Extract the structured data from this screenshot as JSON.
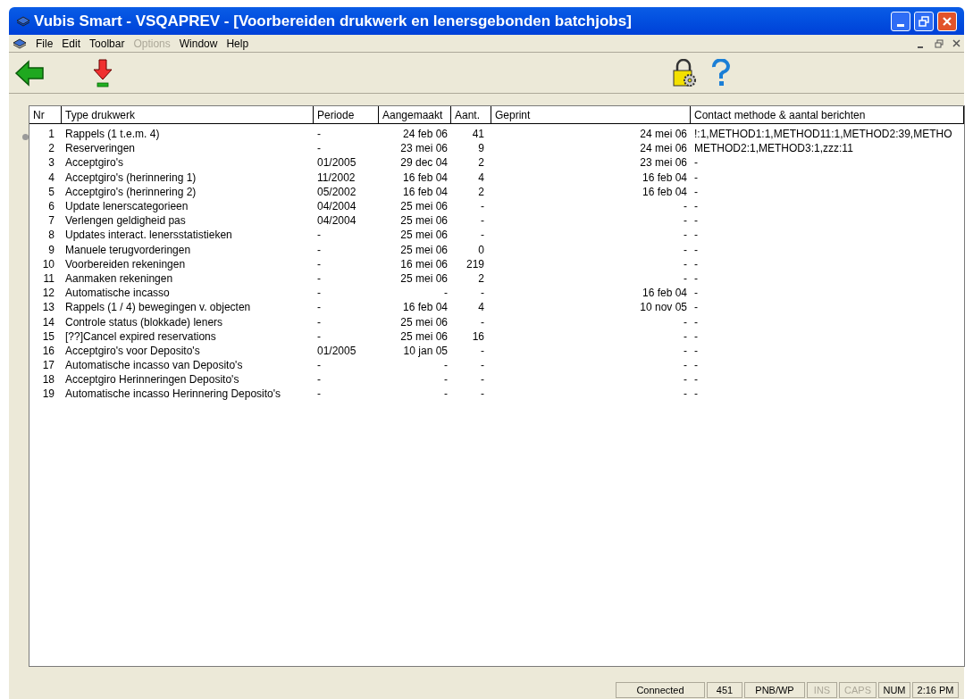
{
  "window": {
    "title": "Vubis Smart - VSQAPREV - [Voorbereiden drukwerk en lenersgebonden batchjobs]"
  },
  "menu": [
    {
      "label": "File",
      "disabled": false
    },
    {
      "label": "Edit",
      "disabled": false
    },
    {
      "label": "Toolbar",
      "disabled": false
    },
    {
      "label": "Options",
      "disabled": true
    },
    {
      "label": "Window",
      "disabled": false
    },
    {
      "label": "Help",
      "disabled": false
    }
  ],
  "table": {
    "columns": [
      "Nr",
      "Type drukwerk",
      "Periode",
      "Aangemaakt",
      "Aant.",
      "Geprint",
      "Contact methode & aantal berichten"
    ],
    "rows": [
      {
        "selected": true,
        "cells": [
          "1",
          "Rappels (1 t.e.m. 4)",
          "-",
          "24 feb 06",
          "41",
          "24 mei 06",
          "!:1,METHOD1:1,METHOD11:1,METHOD2:39,METHO"
        ]
      },
      {
        "selected": false,
        "cells": [
          "2",
          "Reserveringen",
          "-",
          "23 mei 06",
          "9",
          "24 mei 06",
          "METHOD2:1,METHOD3:1,zzz:11"
        ]
      },
      {
        "selected": false,
        "cells": [
          "3",
          "Acceptgiro's",
          "01/2005",
          "29 dec 04",
          "2",
          "23 mei 06",
          "-"
        ]
      },
      {
        "selected": false,
        "cells": [
          "4",
          "Acceptgiro's (herinnering 1)",
          "11/2002",
          "16 feb 04",
          "4",
          "16 feb 04",
          "-"
        ]
      },
      {
        "selected": false,
        "cells": [
          "5",
          "Acceptgiro's (herinnering 2)",
          "05/2002",
          "16 feb 04",
          "2",
          "16 feb 04",
          "-"
        ]
      },
      {
        "selected": false,
        "cells": [
          "6",
          "Update lenerscategorieen",
          "04/2004",
          "25 mei 06",
          "-",
          "-",
          "-"
        ]
      },
      {
        "selected": false,
        "cells": [
          "7",
          "Verlengen geldigheid pas",
          "04/2004",
          "25 mei 06",
          "-",
          "-",
          "-"
        ]
      },
      {
        "selected": false,
        "cells": [
          "8",
          "Updates interact. lenersstatistieken",
          "-",
          "25 mei 06",
          "-",
          "-",
          "-"
        ]
      },
      {
        "selected": false,
        "cells": [
          "9",
          "Manuele terugvorderingen",
          "-",
          "25 mei 06",
          "0",
          "-",
          "-"
        ]
      },
      {
        "selected": false,
        "cells": [
          "10",
          "Voorbereiden rekeningen",
          "-",
          "16 mei 06",
          "219",
          "-",
          "-"
        ]
      },
      {
        "selected": false,
        "cells": [
          "11",
          "Aanmaken rekeningen",
          "-",
          "25 mei 06",
          "2",
          "-",
          "-"
        ]
      },
      {
        "selected": false,
        "cells": [
          "12",
          "Automatische incasso",
          "-",
          "-",
          "-",
          "16 feb 04",
          "-"
        ]
      },
      {
        "selected": false,
        "cells": [
          "13",
          "Rappels (1 / 4) bewegingen v. objecten",
          "-",
          "16 feb 04",
          "4",
          "10 nov 05",
          "-"
        ]
      },
      {
        "selected": false,
        "cells": [
          "14",
          "Controle status (blokkade) leners",
          "-",
          "25 mei 06",
          "-",
          "-",
          "-"
        ]
      },
      {
        "selected": false,
        "cells": [
          "15",
          "[??]Cancel expired reservations",
          "-",
          "25 mei 06",
          "16",
          "-",
          "-"
        ]
      },
      {
        "selected": false,
        "cells": [
          "16",
          "Acceptgiro's voor Deposito's",
          "01/2005",
          "10 jan 05",
          "-",
          "-",
          "-"
        ]
      },
      {
        "selected": false,
        "cells": [
          "17",
          "Automatische incasso van Deposito's",
          "-",
          "-",
          "-",
          "-",
          "-"
        ]
      },
      {
        "selected": false,
        "cells": [
          "18",
          "Acceptgiro Herinneringen Deposito's",
          "-",
          "-",
          "-",
          "-",
          "-"
        ]
      },
      {
        "selected": false,
        "cells": [
          "19",
          "Automatische incasso Herinnering Deposito's",
          "-",
          "-",
          "-",
          "-",
          "-"
        ]
      }
    ]
  },
  "status_bar": [
    {
      "text": "Connected",
      "disabled": false
    },
    {
      "text": "451",
      "disabled": false
    },
    {
      "text": "PNB/WP",
      "disabled": false
    },
    {
      "text": "INS",
      "disabled": true
    },
    {
      "text": "CAPS",
      "disabled": true
    },
    {
      "text": "NUM",
      "disabled": false
    },
    {
      "text": "2:16 PM",
      "disabled": false
    }
  ]
}
